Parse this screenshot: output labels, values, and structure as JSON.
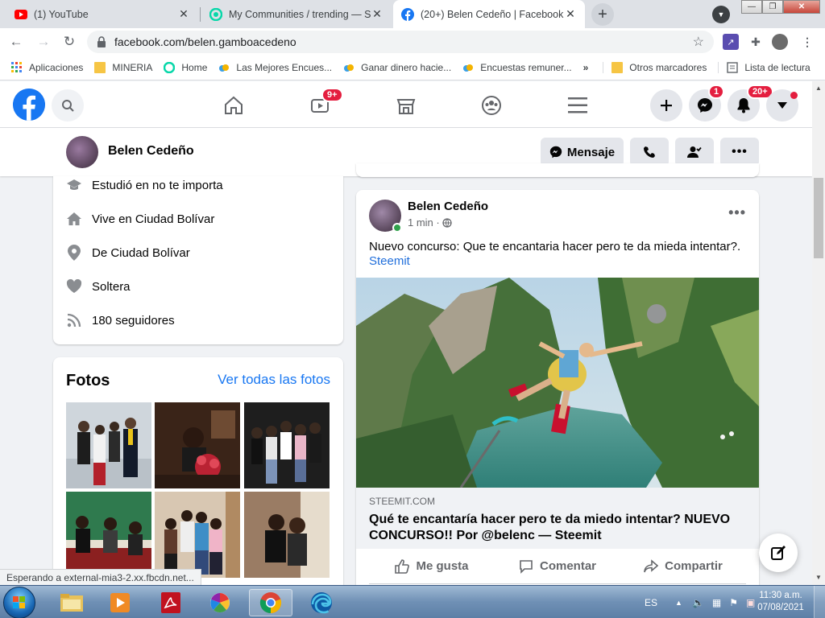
{
  "browser": {
    "tabs": [
      {
        "title": "(1) YouTube",
        "icon": "youtube-icon",
        "active": false
      },
      {
        "title": "My Communities / trending — St",
        "icon": "steemit-icon",
        "active": false
      },
      {
        "title": "(20+) Belen Cedeño | Facebook",
        "icon": "facebook-icon",
        "active": true
      }
    ],
    "address": "facebook.com/belen.gamboacedeno",
    "bookmarks": [
      {
        "label": "Aplicaciones",
        "icon": "apps-grid-icon"
      },
      {
        "label": "MINERIA",
        "icon": "folder-icon"
      },
      {
        "label": "Home",
        "icon": "steemit-icon"
      },
      {
        "label": "Las Mejores Encues...",
        "icon": "cloud-icon"
      },
      {
        "label": "Ganar dinero hacie...",
        "icon": "cloud-icon"
      },
      {
        "label": "Encuestas remuner...",
        "icon": "cloud-icon"
      }
    ],
    "bookmarks_overflow": "»",
    "other_bookmarks": "Otros marcadores",
    "reading_list": "Lista de lectura",
    "status_text": "Esperando a external-mia3-2.xx.fbcdn.net..."
  },
  "fb": {
    "nav": {
      "watch_badge": "9+",
      "messenger_badge": "1",
      "notifications_badge": "20+"
    },
    "profile_header": {
      "name": "Belen Cedeño",
      "message_label": "Mensaje"
    },
    "intro": [
      {
        "icon": "graduation-cap-icon",
        "text": "Estudió en no te importa"
      },
      {
        "icon": "home-icon",
        "text": "Vive en Ciudad Bolívar"
      },
      {
        "icon": "location-pin-icon",
        "text": "De Ciudad Bolívar"
      },
      {
        "icon": "heart-icon",
        "text": "Soltera"
      },
      {
        "icon": "rss-icon",
        "text": "180 seguidores"
      }
    ],
    "photos": {
      "title": "Fotos",
      "see_all": "Ver todas las fotos"
    },
    "post": {
      "author": "Belen Cedeño",
      "time": "1 min · ",
      "text": "Nuevo concurso: Que te encantaria hacer pero te da mieda intentar?.",
      "link": "Steemit",
      "preview_domain": "STEEMIT.COM",
      "preview_title": "Qué te encantaría hacer pero te da miedo intentar? NUEVO CONCURSO!! Por @belenc — Steemit",
      "actions": {
        "like": "Me gusta",
        "comment": "Comentar",
        "share": "Compartir"
      }
    }
  },
  "taskbar": {
    "language": "ES",
    "time": "11:30 a.m.",
    "date": "07/08/2021"
  }
}
